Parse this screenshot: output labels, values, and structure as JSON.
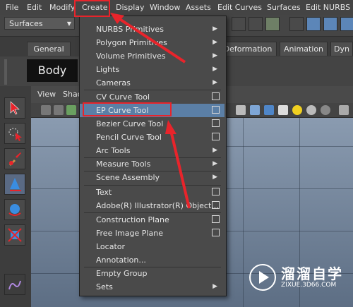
{
  "menubar": {
    "items": [
      "File",
      "Edit",
      "Modify",
      "Create",
      "Display",
      "Window",
      "Assets",
      "Edit Curves",
      "Surfaces",
      "Edit NURBS"
    ]
  },
  "toolbar": {
    "mode": "Surfaces"
  },
  "shelf": {
    "tabs": [
      "General",
      "Deformation",
      "Animation",
      "Dyn"
    ],
    "body_face": "Body Face"
  },
  "viewport": {
    "menus": [
      "View",
      "Shad"
    ]
  },
  "create_menu": {
    "items": [
      {
        "label": "NURBS Primitives",
        "submenu": true
      },
      {
        "label": "Polygon Primitives",
        "submenu": true
      },
      {
        "label": "Volume Primitives",
        "submenu": true
      },
      {
        "label": "Lights",
        "submenu": true
      },
      {
        "label": "Cameras",
        "submenu": true
      },
      {
        "label": "CV Curve Tool",
        "option_box": true
      },
      {
        "label": "EP Curve Tool",
        "option_box": true
      },
      {
        "label": "Bezier Curve Tool",
        "option_box": true
      },
      {
        "label": "Pencil Curve Tool",
        "option_box": true
      },
      {
        "label": "Arc Tools",
        "submenu": true
      },
      {
        "label": "Measure Tools",
        "submenu": true
      },
      {
        "label": "Scene Assembly",
        "submenu": true
      },
      {
        "label": "Text",
        "option_box": true
      },
      {
        "label": "Adobe(R) Illustrator(R) Object...",
        "option_box": true
      },
      {
        "label": "Construction Plane",
        "option_box": true
      },
      {
        "label": "Free Image Plane",
        "option_box": true
      },
      {
        "label": "Locator"
      },
      {
        "label": "Annotation..."
      },
      {
        "label": "Empty Group"
      },
      {
        "label": "Sets",
        "submenu": true
      }
    ],
    "highlighted": "EP Curve Tool"
  },
  "watermark": {
    "title": "溜溜自学",
    "url": "ZIXUE.3D66.COM"
  },
  "colors": {
    "accent_red": "#e8242b",
    "highlight": "#5b7fa6",
    "viewport_top": "#8a9bb0"
  }
}
